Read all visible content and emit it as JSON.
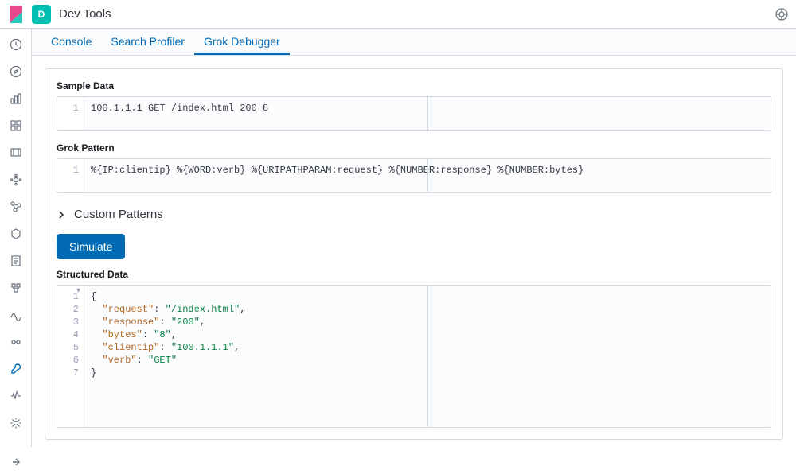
{
  "header": {
    "app_badge": "D",
    "app_title": "Dev Tools"
  },
  "tabs": [
    {
      "id": "console",
      "label": "Console",
      "active": false
    },
    {
      "id": "profiler",
      "label": "Search Profiler",
      "active": false
    },
    {
      "id": "grok",
      "label": "Grok Debugger",
      "active": true
    }
  ],
  "sections": {
    "sample_data": {
      "label": "Sample Data",
      "line_numbers": [
        "1"
      ],
      "content": "100.1.1.1 GET /index.html 200 8"
    },
    "grok_pattern": {
      "label": "Grok Pattern",
      "line_numbers": [
        "1"
      ],
      "content": "%{IP:clientip} %{WORD:verb} %{URIPATHPARAM:request} %{NUMBER:response} %{NUMBER:bytes}"
    },
    "custom_patterns": {
      "label": "Custom Patterns",
      "expanded": false
    },
    "simulate_button": "Simulate",
    "structured_data": {
      "label": "Structured Data",
      "line_numbers": [
        "1",
        "2",
        "3",
        "4",
        "5",
        "6",
        "7"
      ],
      "result": {
        "request": "/index.html",
        "response": "200",
        "bytes": "8",
        "clientip": "100.1.1.1",
        "verb": "GET"
      }
    }
  },
  "sidenav_items": [
    "recent-icon",
    "discover-icon",
    "dashboard-icon",
    "canvas-icon",
    "maps-icon",
    "ml-icon",
    "graph-icon",
    "app-search-icon",
    "logs-icon",
    "infra-icon",
    "apm-icon",
    "dev-tools-icon",
    "monitoring-icon",
    "management-icon"
  ]
}
